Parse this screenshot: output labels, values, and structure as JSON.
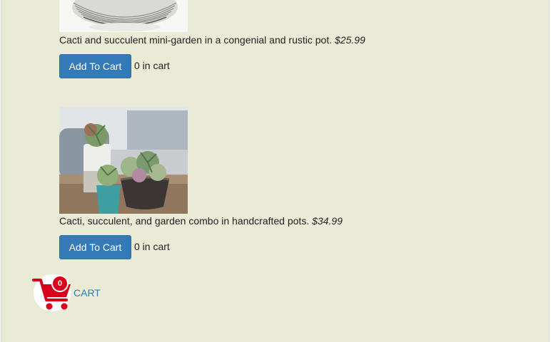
{
  "products": [
    {
      "image_icon": "plate-stack-image",
      "description": "Cacti and succulent mini-garden in a congenial and rustic pot.",
      "price": "$25.99",
      "button_label": "Add To Cart",
      "cart_count_text": "0 in cart"
    },
    {
      "image_icon": "succulent-pots-image",
      "description": "Cacti, succulent, and garden combo in handcrafted pots.",
      "price": "$34.99",
      "button_label": "Add To Cart",
      "cart_count_text": "0 in cart"
    }
  ],
  "cart": {
    "icon": "shopping-cart-icon",
    "badge_count": "0",
    "label": "CART",
    "color": "#d9001b"
  },
  "colors": {
    "page_background": "#eaebd6",
    "button_primary": "#337ab7",
    "link": "#337ab7"
  }
}
